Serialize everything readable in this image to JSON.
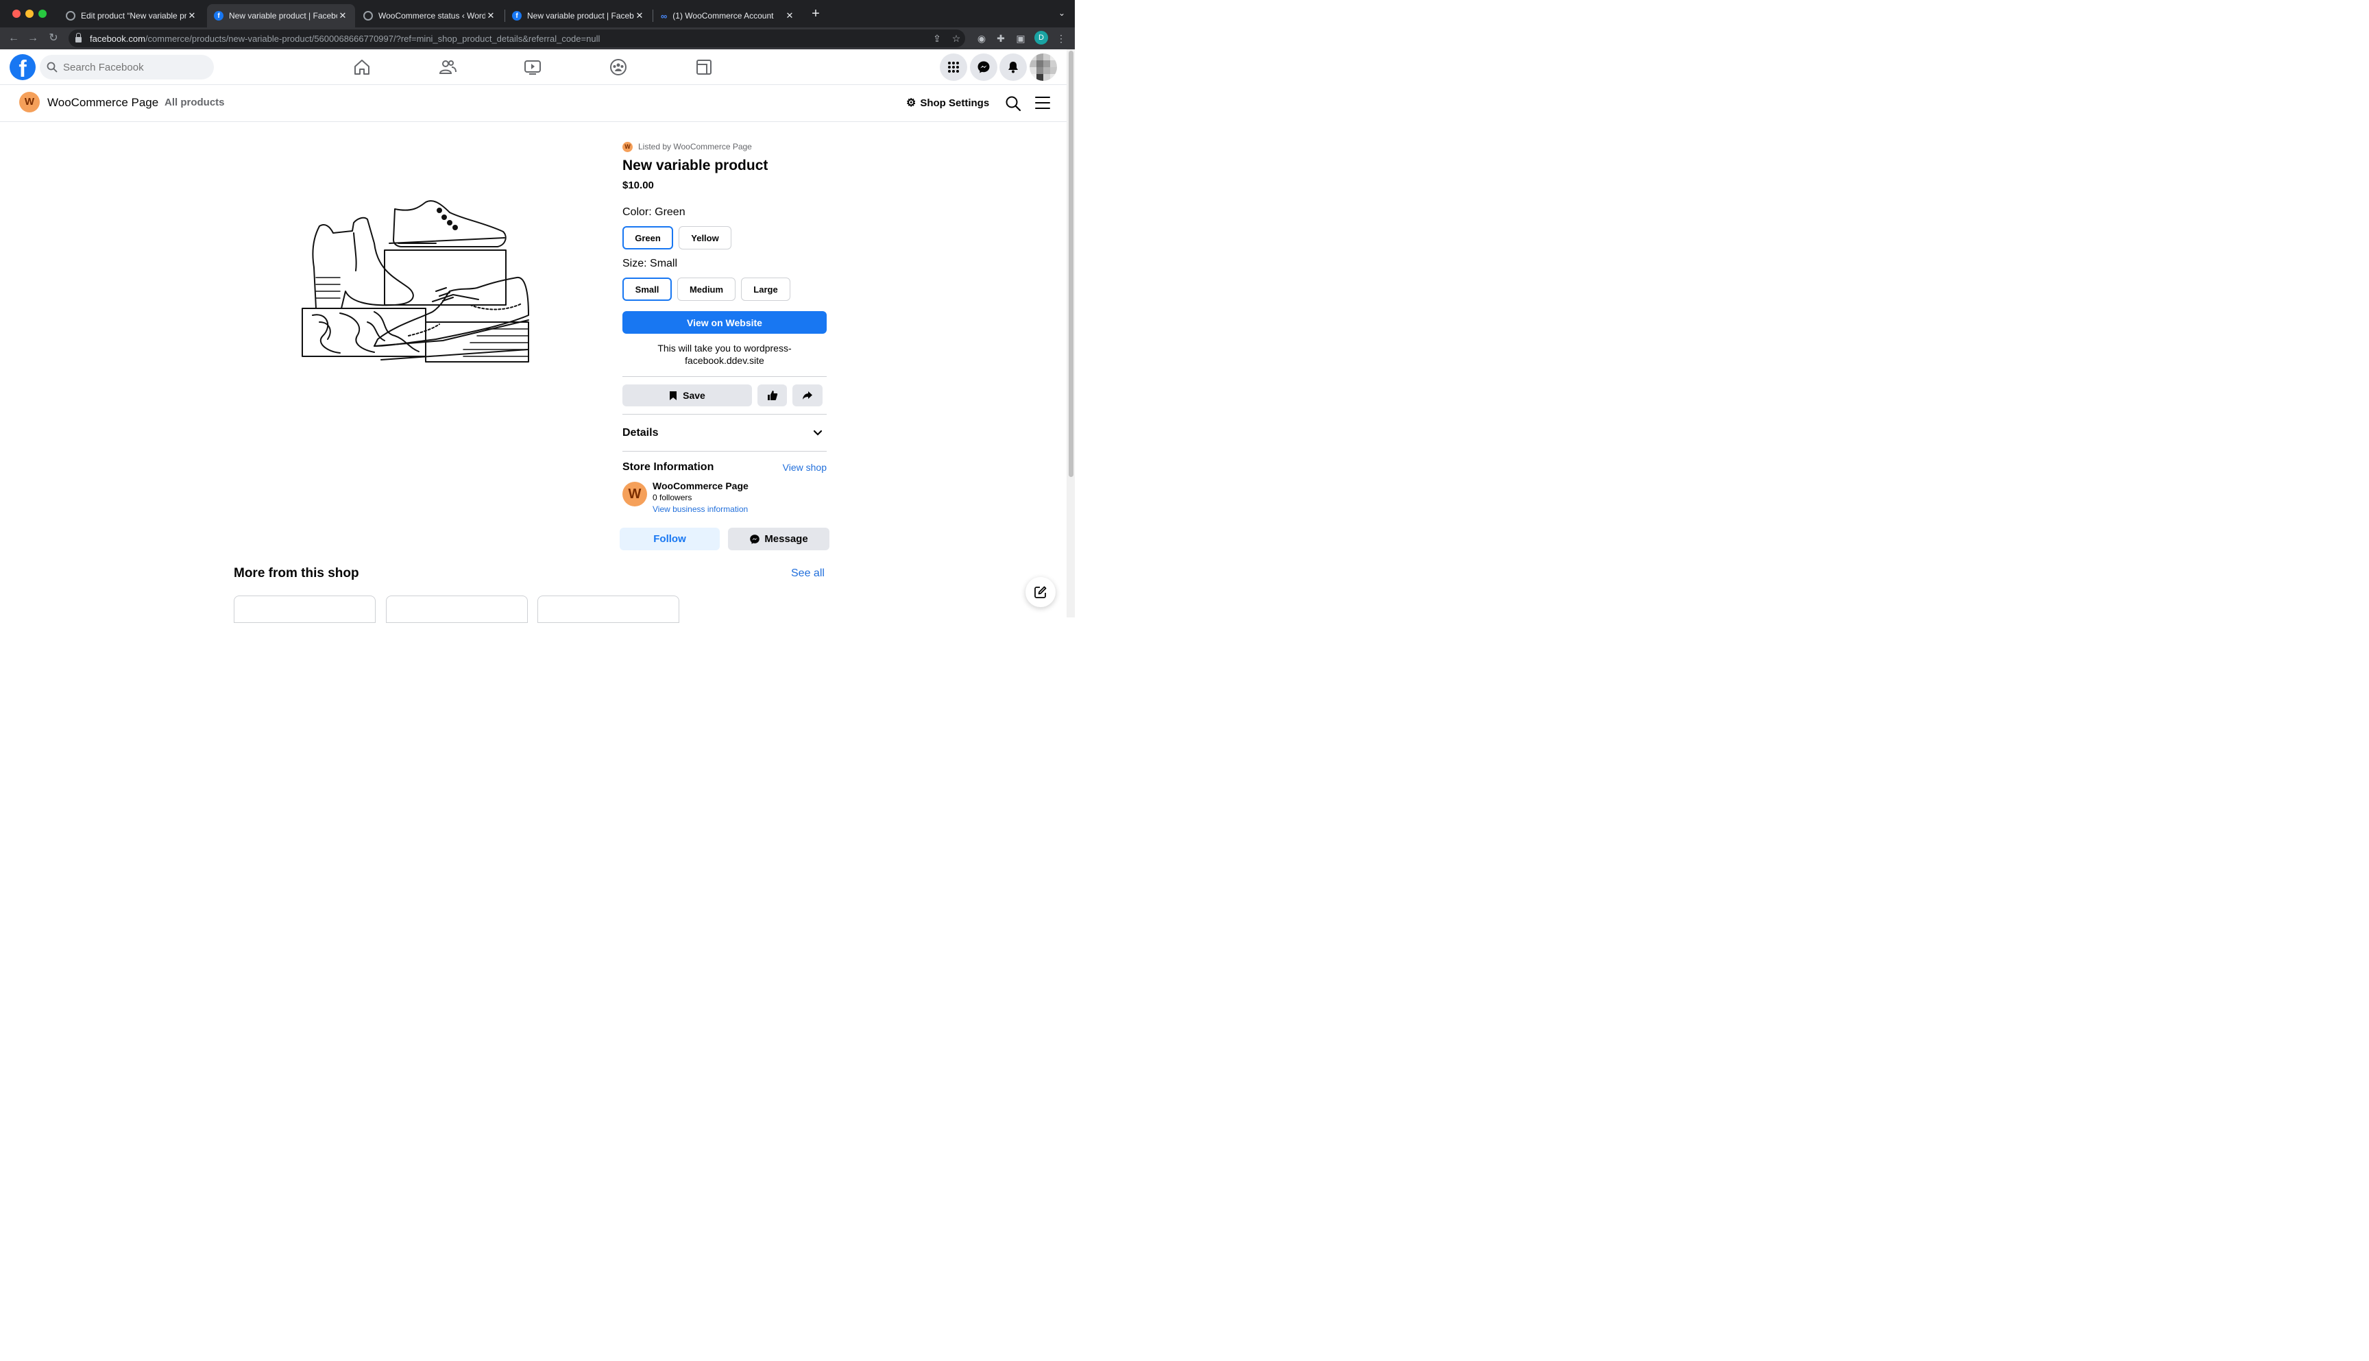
{
  "browser": {
    "tabs": [
      {
        "title": "Edit product “New variable pro",
        "favicon": "globe-icon",
        "active": false
      },
      {
        "title": "New variable product | Facebo",
        "favicon": "facebook-icon",
        "active": true
      },
      {
        "title": "WooCommerce status ‹ WordP",
        "favicon": "globe-icon",
        "active": false
      },
      {
        "title": "New variable product | Facebo",
        "favicon": "facebook-icon",
        "active": false
      },
      {
        "title": "(1) WooCommerce Account",
        "favicon": "meta-icon",
        "active": false
      }
    ],
    "url_host": "facebook.com",
    "url_path": "/commerce/products/new-variable-product/5600068666770997/?ref=mini_shop_product_details&referral_code=null",
    "profile_initial": "D"
  },
  "fb": {
    "logo_letter": "f",
    "search_placeholder": "Search Facebook"
  },
  "shop": {
    "avatar_letter": "W",
    "name": "WooCommerce Page",
    "all_products": "All products",
    "settings": "Shop Settings"
  },
  "product": {
    "listed_by": "Listed by WooCommerce Page",
    "title": "New variable product",
    "price": "$10.00",
    "color_label": "Color: Green",
    "colors": [
      "Green",
      "Yellow"
    ],
    "size_label": "Size: Small",
    "sizes": [
      "Small",
      "Medium",
      "Large"
    ],
    "view_button": "View on Website",
    "redirect_note": "This will take you to wordpress-facebook.ddev.site",
    "save": "Save",
    "details": "Details"
  },
  "store": {
    "title": "Store Information",
    "view_shop": "View shop",
    "name": "WooCommerce Page",
    "followers": "0 followers",
    "business_link": "View business information",
    "follow": "Follow",
    "message": "Message"
  },
  "more": {
    "title": "More from this shop",
    "see_all": "See all"
  }
}
